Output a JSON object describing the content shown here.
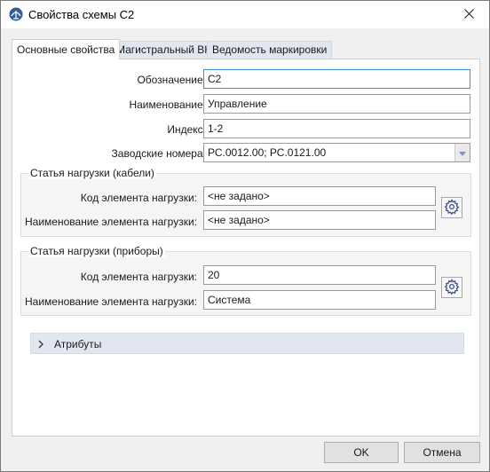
{
  "window": {
    "title": "Свойства схемы С2",
    "icon": "app-logo-icon"
  },
  "tabs": [
    {
      "label": "Основные свойства",
      "active": true
    },
    {
      "label": "Магистральный ВК",
      "active": false
    },
    {
      "label": "Ведомость маркировки",
      "active": false
    }
  ],
  "main": {
    "designation_label": "Обозначение:",
    "designation_value": "С2",
    "name_label": "Наименование:",
    "name_value": "Управление",
    "index_label": "Индекс:",
    "index_value": "1-2",
    "serials_label": "Заводские номера:",
    "serials_value": "РС.0012.00; РС.0121.00"
  },
  "cables_group": {
    "title": "Статья нагрузки (кабели)",
    "code_label": "Код элемента нагрузки:",
    "code_value": "<не задано>",
    "name_label": "Наименование элемента нагрузки:",
    "name_value": "<не задано>"
  },
  "devices_group": {
    "title": "Статья нагрузки (приборы)",
    "code_label": "Код элемента нагрузки:",
    "code_value": "20",
    "name_label": "Наименование элемента нагрузки:",
    "name_value": "Система"
  },
  "attributes": {
    "label": "Атрибуты",
    "expanded": false
  },
  "buttons": {
    "ok": "OK",
    "cancel": "Отмена"
  },
  "colors": {
    "accent": "#3b8fd1",
    "tab_inactive": "#e1e6f0"
  }
}
